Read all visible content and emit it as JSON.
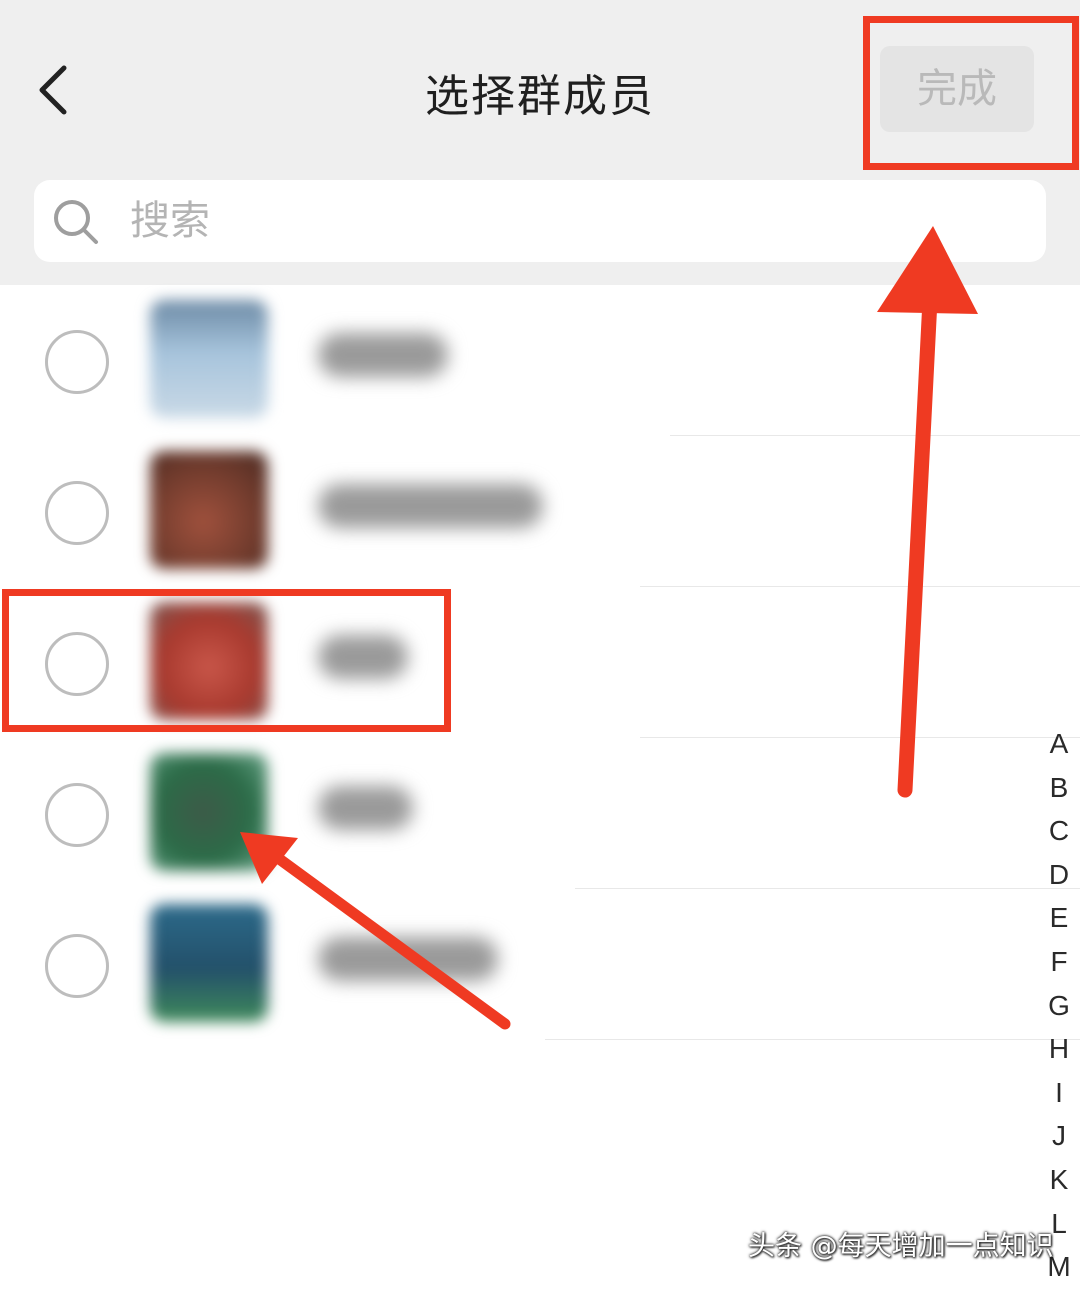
{
  "header": {
    "title": "选择群成员",
    "done_label": "完成"
  },
  "search": {
    "placeholder": "搜索"
  },
  "members": [
    {
      "selected": false,
      "avatar_color": "#7fa5c4"
    },
    {
      "selected": false,
      "avatar_color": "#8a4a3a"
    },
    {
      "selected": false,
      "avatar_color": "#b5453a"
    },
    {
      "selected": false,
      "avatar_color": "#2f5a40"
    },
    {
      "selected": false,
      "avatar_color": "#2e5f70"
    }
  ],
  "alphabet_index": [
    "A",
    "B",
    "C",
    "D",
    "E",
    "F",
    "G",
    "H",
    "I",
    "J",
    "K",
    "L",
    "M"
  ],
  "icons": {
    "back": "chevron-left-icon",
    "search": "search-icon"
  },
  "colors": {
    "annotation": "#ef3a22",
    "done_disabled_text": "#b9b9b9",
    "radio_border": "#bdbdbd"
  },
  "watermark": {
    "text": "头条 @每天增加一点知识"
  }
}
